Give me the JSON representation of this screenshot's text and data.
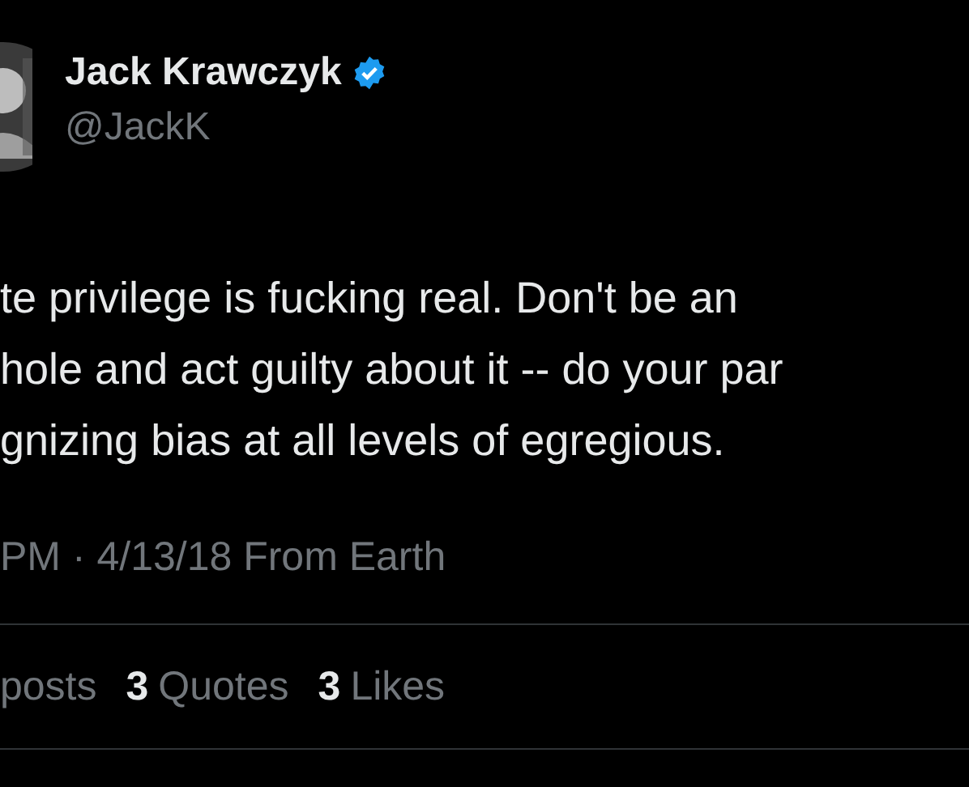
{
  "author": {
    "name": "Jack Krawczyk",
    "verified": true,
    "handle": "@JackK"
  },
  "body_lines": [
    "te privilege is fucking real. Don't be an",
    "hole and act guilty about it -- do your par",
    "gnizing bias at all levels of egregious."
  ],
  "timestamp": "PM · 4/13/18 From Earth",
  "stats": [
    {
      "label": "posts"
    },
    {
      "count": "3",
      "label": "Quotes"
    },
    {
      "count": "3",
      "label": "Likes"
    }
  ]
}
